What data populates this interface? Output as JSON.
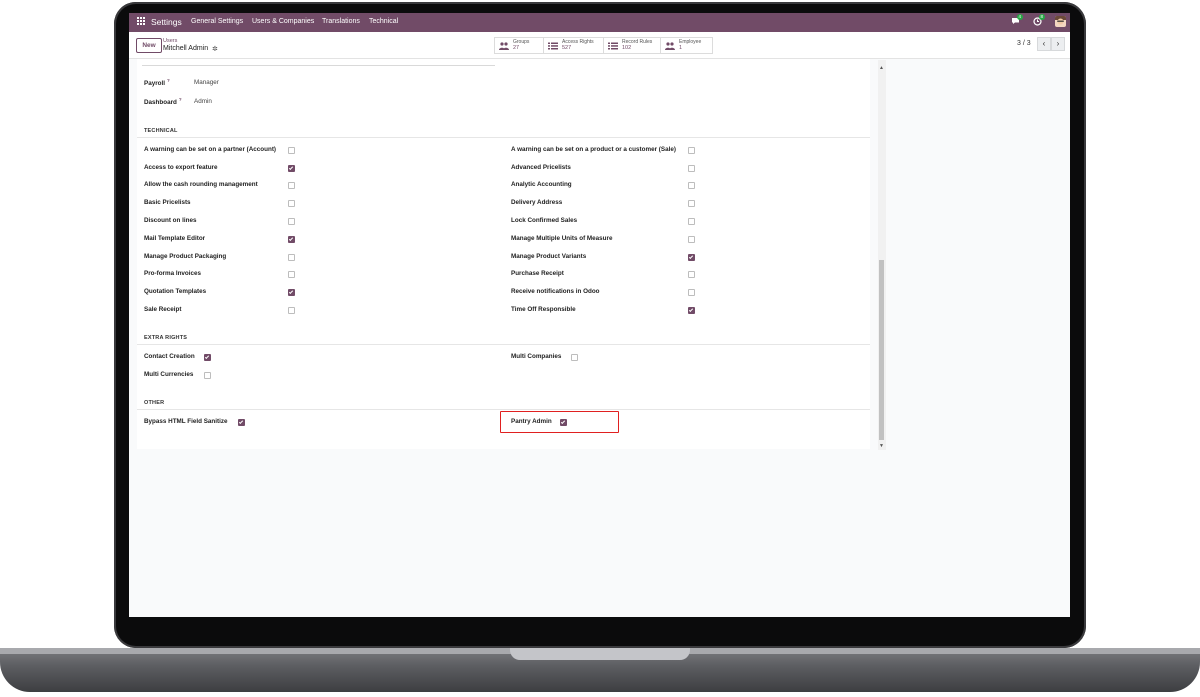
{
  "navbar": {
    "brand": "Settings",
    "menu": [
      "General Settings",
      "Users & Companies",
      "Translations",
      "Technical"
    ],
    "chat_badge": "4",
    "activity_badge": "8"
  },
  "control_panel": {
    "new_label": "New",
    "breadcrumb_parent": "Users",
    "record_name": "Mitchell Admin",
    "smart_buttons": [
      {
        "label": "Groups",
        "value": "27",
        "icon": "users-icon"
      },
      {
        "label": "Access Rights",
        "value": "527",
        "icon": "list-icon"
      },
      {
        "label": "Record Rules",
        "value": "102",
        "icon": "list-icon"
      },
      {
        "label": "Employee",
        "value": "1",
        "icon": "users-icon"
      }
    ],
    "pager": "3 / 3"
  },
  "fields": {
    "payroll": {
      "label": "Payroll",
      "help": "?",
      "value": "Manager"
    },
    "dashboard": {
      "label": "Dashboard",
      "help": "?",
      "value": "Admin"
    }
  },
  "technical": {
    "title": "TECHNICAL",
    "left": [
      {
        "label": "A warning can be set on a partner (Account)",
        "checked": false
      },
      {
        "label": "Access to export feature",
        "checked": true
      },
      {
        "label": "Allow the cash rounding management",
        "checked": false
      },
      {
        "label": "Basic Pricelists",
        "checked": false
      },
      {
        "label": "Discount on lines",
        "checked": false
      },
      {
        "label": "Mail Template Editor",
        "checked": true
      },
      {
        "label": "Manage Product Packaging",
        "checked": false
      },
      {
        "label": "Pro-forma Invoices",
        "checked": false
      },
      {
        "label": "Quotation Templates",
        "checked": true
      },
      {
        "label": "Sale Receipt",
        "checked": false
      }
    ],
    "right": [
      {
        "label": "A warning can be set on a product or a customer (Sale)",
        "checked": false
      },
      {
        "label": "Advanced Pricelists",
        "checked": false
      },
      {
        "label": "Analytic Accounting",
        "checked": false
      },
      {
        "label": "Delivery Address",
        "checked": false
      },
      {
        "label": "Lock Confirmed Sales",
        "checked": false
      },
      {
        "label": "Manage Multiple Units of Measure",
        "checked": false
      },
      {
        "label": "Manage Product Variants",
        "checked": true
      },
      {
        "label": "Purchase Receipt",
        "checked": false
      },
      {
        "label": "Receive notifications in Odoo",
        "checked": false
      },
      {
        "label": "Time Off Responsible",
        "checked": true
      }
    ]
  },
  "extra_rights": {
    "title": "EXTRA RIGHTS",
    "left": [
      {
        "label": "Contact Creation",
        "checked": true
      },
      {
        "label": "Multi Currencies",
        "checked": false
      }
    ],
    "right": [
      {
        "label": "Multi Companies",
        "checked": false
      }
    ]
  },
  "other": {
    "title": "OTHER",
    "left": [
      {
        "label": "Bypass HTML Field Sanitize",
        "checked": true
      }
    ],
    "right": [
      {
        "label": "Pantry Admin",
        "checked": true
      }
    ]
  },
  "colors": {
    "brand": "#714b67",
    "highlight": "#e02020"
  }
}
